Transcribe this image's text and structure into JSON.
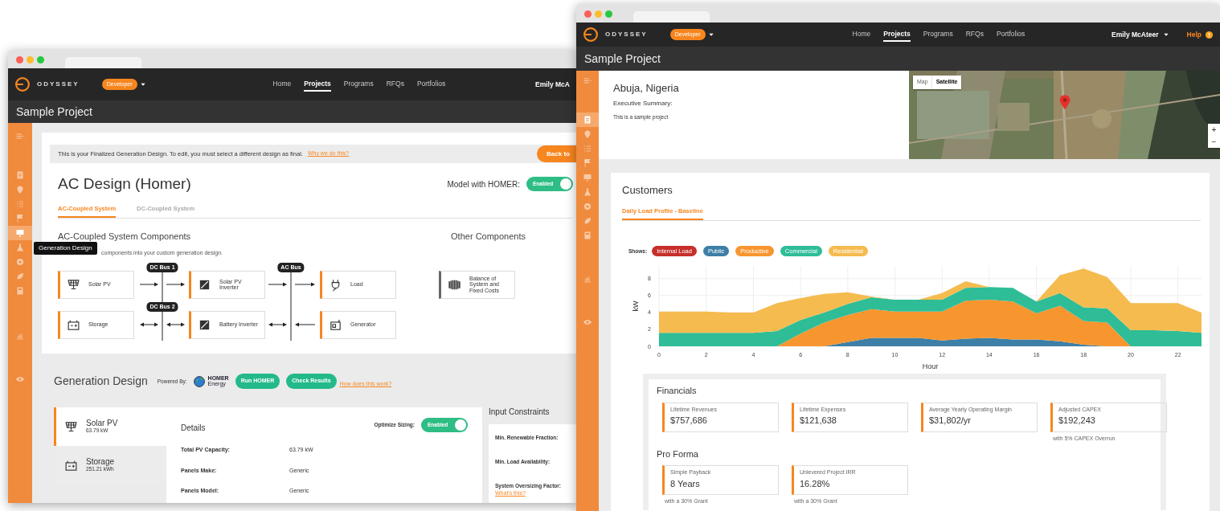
{
  "left_window": {
    "nav": {
      "logo": "ODYSSEY",
      "role": "Developer",
      "links": [
        {
          "label": "Home",
          "selected": false
        },
        {
          "label": "Projects",
          "selected": true
        },
        {
          "label": "Programs",
          "selected": false
        },
        {
          "label": "RFQs",
          "selected": false
        },
        {
          "label": "Portfolios",
          "selected": false
        }
      ],
      "user": "Emily McA"
    },
    "page_title": "Sample Project",
    "sidebar": [
      {
        "selected": false
      },
      {
        "selected": false
      },
      {
        "selected": false
      },
      {
        "selected": false
      },
      {
        "selected": false
      },
      {
        "selected": true
      },
      {
        "selected": false
      },
      {
        "selected": false
      },
      {
        "selected": false
      },
      {
        "selected": false
      },
      {
        "selected": false
      },
      {
        "selected": false
      }
    ],
    "tooltip": "Generation Design",
    "notice": {
      "text": "This is your Finalized Generation Design. To edit, you must select a different design as final.",
      "link": "Why we do this?",
      "button": "Back to"
    },
    "design_title": "AC Design (Homer)",
    "homer_toggle": {
      "label": "Model with HOMER:",
      "state": "Enabled",
      "on": true
    },
    "tabs": [
      {
        "label": "AC-Coupled System",
        "selected": true
      },
      {
        "label": "DC-Coupled System",
        "selected": false
      }
    ],
    "components": {
      "title": "AC-Coupled System Components",
      "subtitle": "components into your custom generation design.",
      "buses": [
        {
          "label": "DC Bus 1"
        },
        {
          "label": "DC Bus 2"
        },
        {
          "label": "AC Bus"
        }
      ],
      "nodes": [
        {
          "label": "Solar PV",
          "kind": "solar"
        },
        {
          "label": "Solar PV Inverter",
          "kind": "inverter"
        },
        {
          "label": "Load",
          "kind": "load"
        },
        {
          "label": "Storage",
          "kind": "storage"
        },
        {
          "label": "Battery Inverter",
          "kind": "inverter"
        },
        {
          "label": "Generator",
          "kind": "generator"
        }
      ]
    },
    "other": {
      "title": "Other Components",
      "nodes": [
        {
          "label": "Balance of System and Fixed Costs",
          "kind": "balance"
        }
      ]
    },
    "generation": {
      "title": "Generation Design",
      "powered_by": "Powered By:",
      "brand": "HOMER",
      "brand_sub": "Energy",
      "buttons": [
        "Run HOMER",
        "Check Results"
      ],
      "help_link": "How does this work?",
      "components": [
        {
          "name": "Solar PV",
          "size": "63.79 kW",
          "kind": "solar",
          "selected": true
        },
        {
          "name": "Storage",
          "size": "251.21 kWh",
          "kind": "storage",
          "selected": false
        }
      ],
      "details_title": "Details",
      "optimize": {
        "label": "Optimize Sizing:",
        "state": "Enabled",
        "on": true
      },
      "details": [
        {
          "label": "Total PV Capacity:",
          "value": "63.79 kW"
        },
        {
          "label": "Panels Make:",
          "value": "Generic"
        },
        {
          "label": "Panels Model:",
          "value": "Generic"
        }
      ],
      "constraints_title": "Input Constraints",
      "constraints": [
        "Min. Renewable Fraction:",
        "Min. Load Availability:",
        "System Oversizing Factor:"
      ],
      "constraints_link": "What's this?"
    }
  },
  "right_window": {
    "nav": {
      "logo": "ODYSSEY",
      "role": "Developer",
      "links": [
        {
          "label": "Home",
          "selected": false
        },
        {
          "label": "Projects",
          "selected": true
        },
        {
          "label": "Programs",
          "selected": false
        },
        {
          "label": "RFQs",
          "selected": false
        },
        {
          "label": "Portfolios",
          "selected": false
        }
      ],
      "user": "Emily McAteer",
      "help": "Help"
    },
    "page_title": "Sample Project",
    "sidebar": [
      {
        "selected": false
      },
      {
        "selected": true
      },
      {
        "selected": false
      },
      {
        "selected": false
      },
      {
        "selected": false
      },
      {
        "selected": false
      },
      {
        "selected": false
      },
      {
        "selected": false
      },
      {
        "selected": false
      },
      {
        "selected": false
      },
      {
        "selected": false
      },
      {
        "selected": false
      }
    ],
    "project": {
      "location": "Abuja, Nigeria",
      "summary_label": "Executive Summary:",
      "summary": "This is a sample project"
    },
    "map": {
      "types": [
        {
          "label": "Map",
          "selected": false
        },
        {
          "label": "Satellite",
          "selected": true
        }
      ],
      "zoom": [
        "+",
        "−"
      ]
    },
    "customers": {
      "title": "Customers",
      "tabs": [
        {
          "label": "Daily Load Profile - Baseline",
          "selected": true
        }
      ],
      "legend_label": "Shows:",
      "chart_data": {
        "type": "area",
        "stacked": true,
        "grid": true,
        "xlabel": "Hour",
        "ylabel": "kW",
        "x": [
          0,
          1,
          2,
          3,
          4,
          5,
          6,
          7,
          8,
          9,
          10,
          11,
          12,
          13,
          14,
          15,
          16,
          17,
          18,
          19,
          20,
          21,
          22,
          23
        ],
        "xlim": [
          0,
          23
        ],
        "ylim": [
          0,
          9.5
        ],
        "xticks": [
          0,
          2,
          4,
          6,
          8,
          10,
          12,
          14,
          16,
          18,
          20,
          22
        ],
        "yticks": [
          0,
          2,
          4,
          6,
          8
        ],
        "series": [
          {
            "name": "Internal Load",
            "color": "#c62f2a",
            "values": [
              null,
              null,
              null,
              null,
              null,
              null,
              null,
              null,
              null,
              null,
              null,
              null,
              null,
              null,
              null,
              null,
              null,
              null,
              null,
              null,
              null,
              null,
              null,
              null
            ]
          },
          {
            "name": "Public",
            "color": "#3d7fa6",
            "values": [
              0,
              0,
              0,
              0,
              0,
              0,
              0,
              0,
              0.5,
              1,
              1,
              1,
              0.7,
              0.9,
              1,
              0.8,
              0.8,
              0.6,
              0.2,
              0,
              0,
              0,
              0,
              0
            ]
          },
          {
            "name": "Productive",
            "color": "#f7962f",
            "values": [
              0,
              0,
              0,
              0,
              0,
              0,
              1.5,
              2.8,
              3.2,
              3.4,
              3.1,
              3.1,
              3.4,
              4.5,
              4.5,
              4.5,
              3.1,
              4.2,
              2.8,
              2.8,
              0,
              0,
              0,
              0
            ]
          },
          {
            "name": "Commercial",
            "color": "#2ebd97",
            "values": [
              1.6,
              1.6,
              1.6,
              1.6,
              1.6,
              1.8,
              1.6,
              1.2,
              1.3,
              1.4,
              1.4,
              1.4,
              1.4,
              1.5,
              1.5,
              1.6,
              1.4,
              1.5,
              1.6,
              1.7,
              1.9,
              1.9,
              1.8,
              1.6
            ]
          },
          {
            "name": "Residential",
            "color": "#f5bb4f",
            "values": [
              2.5,
              2.5,
              2.5,
              2.4,
              2.4,
              3.3,
              2.6,
              2.2,
              1.4,
              0.1,
              0,
              0,
              0.8,
              0.8,
              0,
              0,
              0,
              2.1,
              4.6,
              3.7,
              3.2,
              3.2,
              3.3,
              2.4
            ]
          }
        ]
      }
    },
    "financials": {
      "title": "Financials",
      "metrics": [
        {
          "label": "Lifetime Revenues",
          "value": "$757,686"
        },
        {
          "label": "Lifetime Expenses",
          "value": "$121,638"
        },
        {
          "label": "Average Yearly Operating Margin",
          "value": "$31,802/yr"
        },
        {
          "label": "Adjusted CAPEX",
          "value": "$192,243",
          "note": "with 5% CAPEX Overrun"
        }
      ]
    },
    "pro_forma": {
      "title": "Pro Forma",
      "metrics": [
        {
          "label": "Simple Payback",
          "value": "8 Years",
          "note": "with a 30% Grant"
        },
        {
          "label": "Unlevered Project IRR",
          "value": "16.28%",
          "note": "with a 30% Grant"
        }
      ]
    }
  }
}
